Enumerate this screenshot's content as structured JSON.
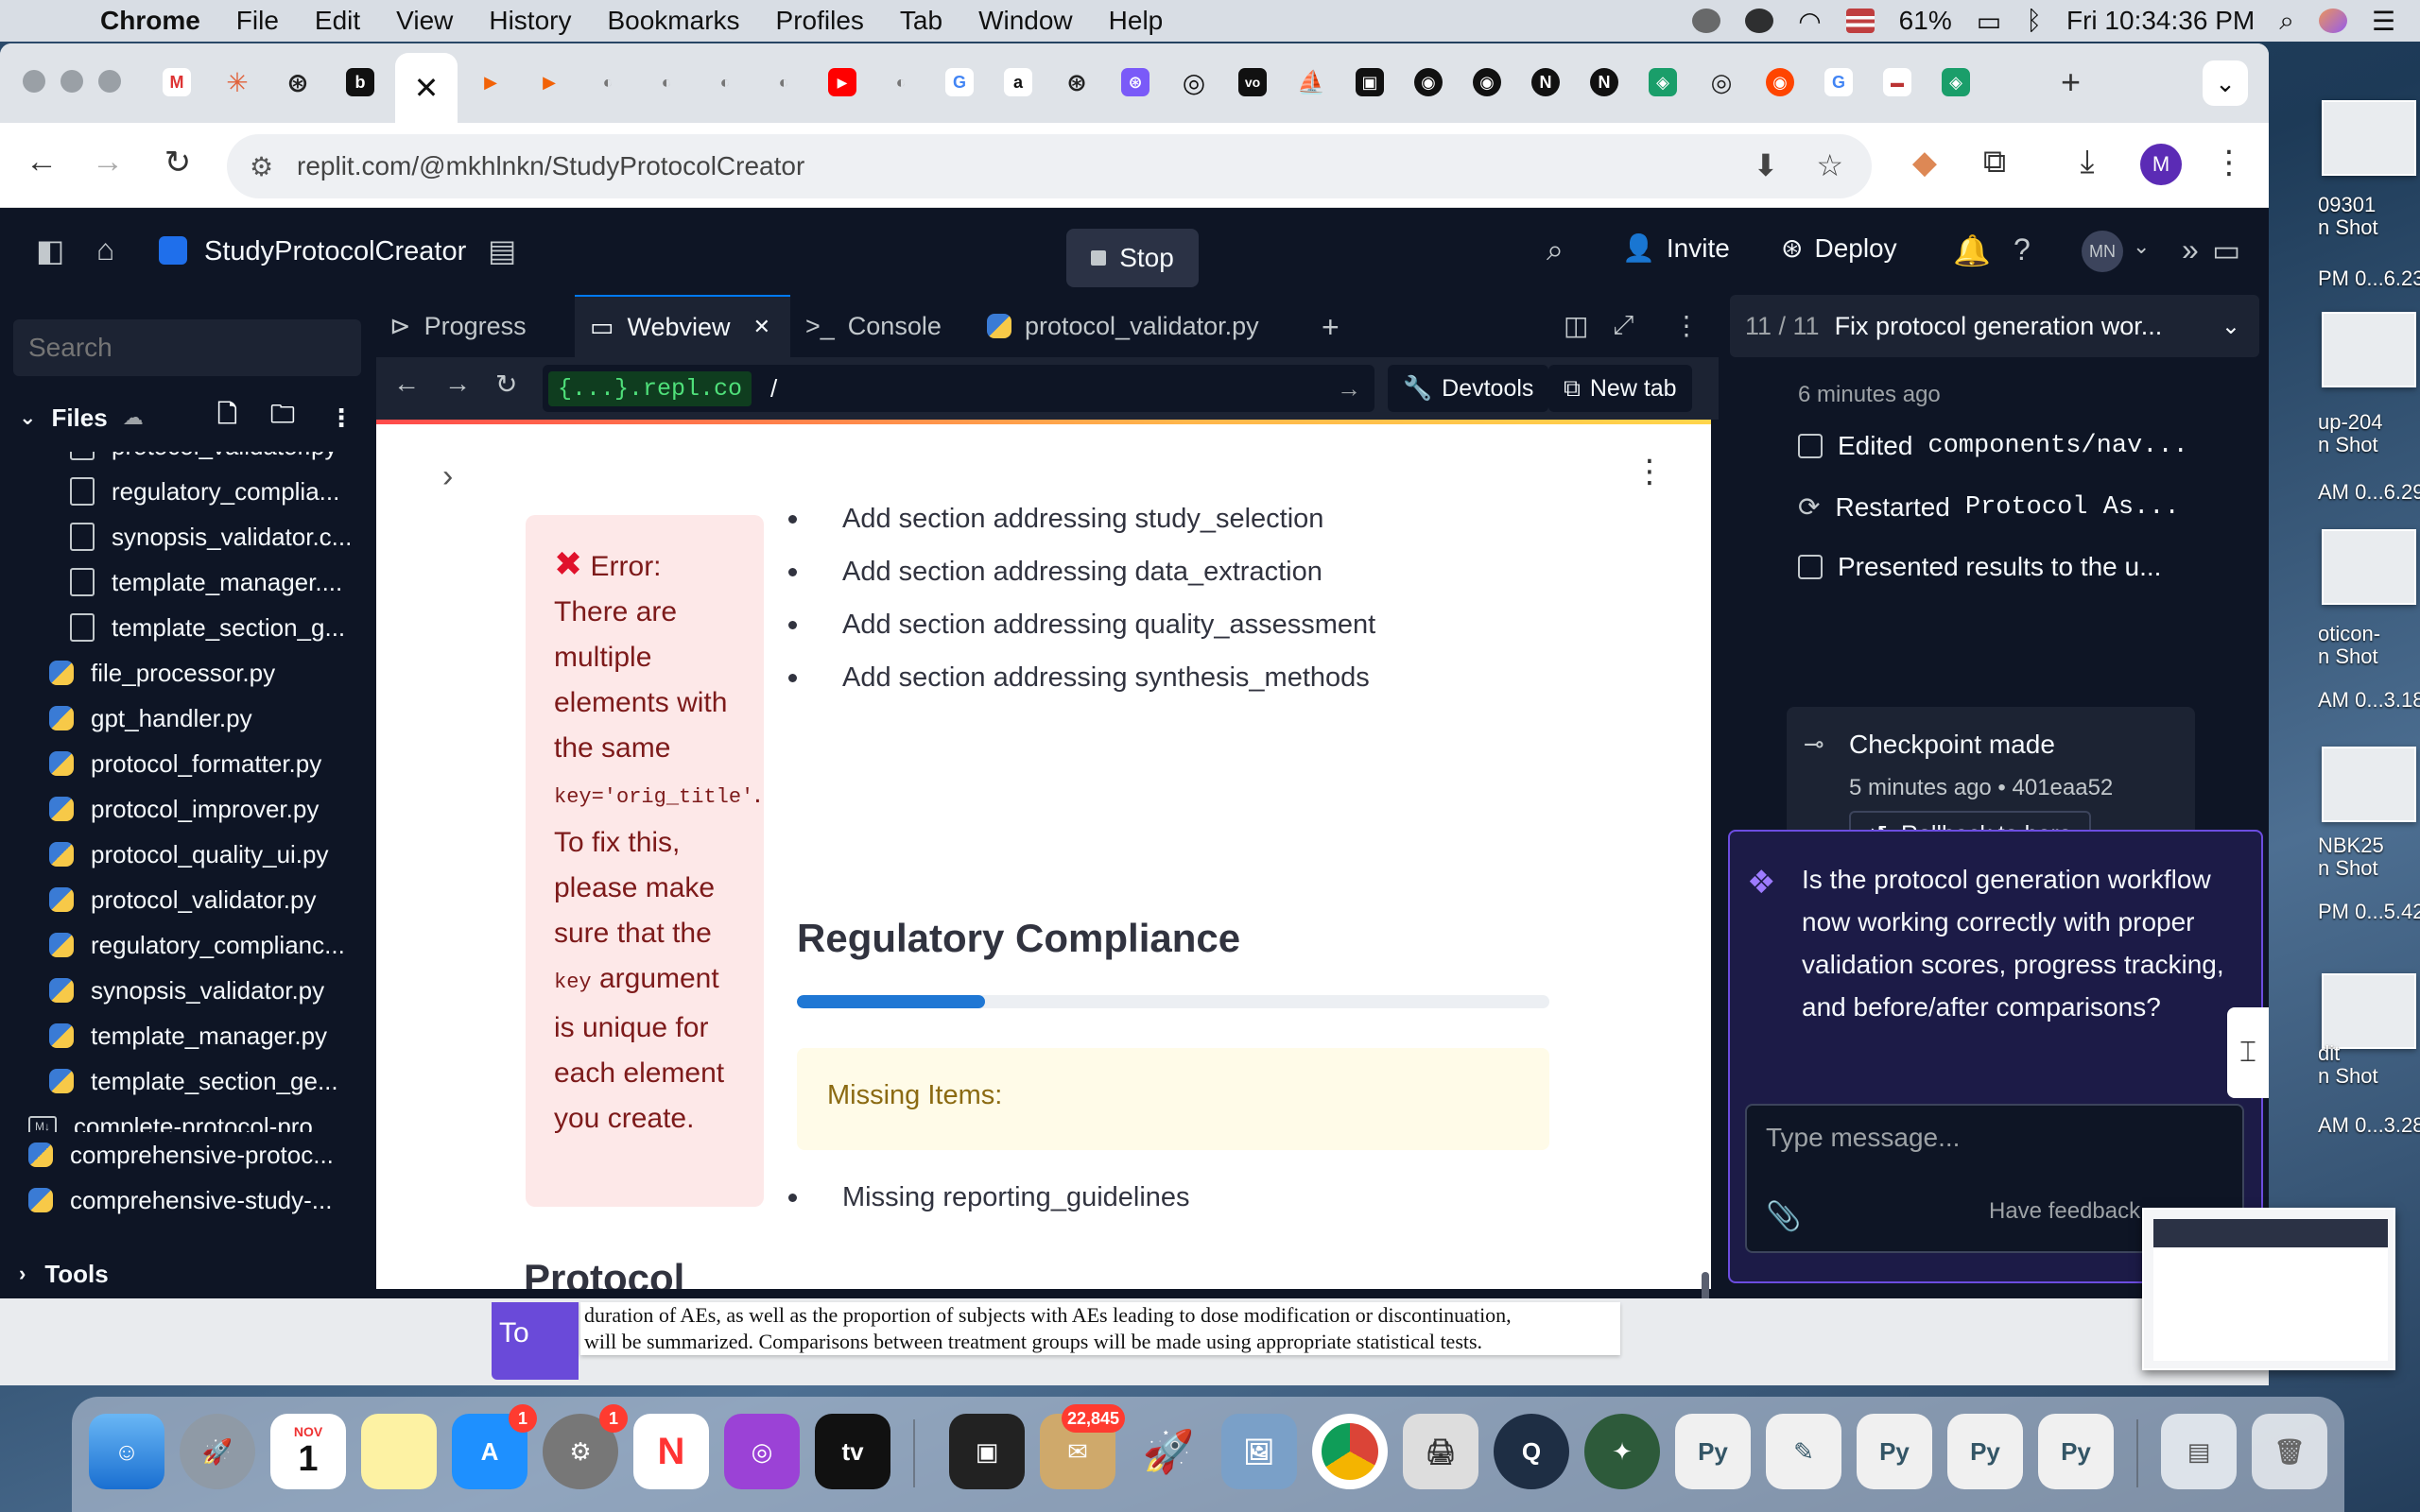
{
  "menubar": {
    "app_name": "Chrome",
    "items": [
      "File",
      "Edit",
      "View",
      "History",
      "Bookmarks",
      "Profiles",
      "Tab",
      "Window",
      "Help"
    ],
    "battery": "61%",
    "clock": "Fri 10:34:36 PM"
  },
  "browser": {
    "url": "replit.com/@mkhlnkn/StudyProtocolCreator",
    "profile_initial": "M",
    "active_tab_glyph": "✕",
    "tab_favicons": [
      "M",
      "✳",
      "⊛",
      "b",
      "▶",
      "▶",
      "◐",
      "◐",
      "◐",
      "◐",
      "▶",
      "◐",
      "G",
      "a",
      "⊛",
      "⊛",
      "◎",
      "vo",
      "⛵",
      "▣",
      "◉",
      "◉",
      "N",
      "N",
      "◈",
      "◎",
      "◉",
      "G",
      "▬",
      "◈"
    ]
  },
  "replit": {
    "project_name": "StudyProtocolCreator",
    "stop_label": "Stop",
    "invite_label": "Invite",
    "deploy_label": "Deploy",
    "avatar_initials": "MN",
    "sidebar": {
      "search_placeholder": "Search",
      "files_label": "Files",
      "tools_label": "Tools",
      "files": [
        {
          "name": "protocol_validator.py",
          "type": "doc",
          "indent": 2
        },
        {
          "name": "regulatory_complia...",
          "type": "doc",
          "indent": 2
        },
        {
          "name": "synopsis_validator.c...",
          "type": "doc",
          "indent": 2
        },
        {
          "name": "template_manager....",
          "type": "doc",
          "indent": 2
        },
        {
          "name": "template_section_g...",
          "type": "doc",
          "indent": 2
        },
        {
          "name": "file_processor.py",
          "type": "py",
          "indent": 1
        },
        {
          "name": "gpt_handler.py",
          "type": "py",
          "indent": 1
        },
        {
          "name": "protocol_formatter.py",
          "type": "py",
          "indent": 1
        },
        {
          "name": "protocol_improver.py",
          "type": "py",
          "indent": 1
        },
        {
          "name": "protocol_quality_ui.py",
          "type": "py",
          "indent": 1
        },
        {
          "name": "protocol_validator.py",
          "type": "py",
          "indent": 1
        },
        {
          "name": "regulatory_complianc...",
          "type": "py",
          "indent": 1
        },
        {
          "name": "synopsis_validator.py",
          "type": "py",
          "indent": 1
        },
        {
          "name": "template_manager.py",
          "type": "py",
          "indent": 1
        },
        {
          "name": "template_section_ge...",
          "type": "py",
          "indent": 1
        },
        {
          "name": "complete-protocol-pro...",
          "type": "md",
          "indent": 0
        },
        {
          "name": "comprehensive-protoc...",
          "type": "py",
          "indent": 0
        },
        {
          "name": "comprehensive-study-...",
          "type": "py",
          "indent": 0
        }
      ]
    },
    "tabs": {
      "progress": "Progress",
      "webview": "Webview",
      "console": "Console",
      "file": "protocol_validator.py"
    },
    "webview_bar": {
      "domain": "{...}.repl.co",
      "path": "/",
      "devtools": "Devtools",
      "new_tab": "New tab"
    },
    "webview": {
      "error_title": "Error:",
      "error_text_1": "There are multiple elements with the same",
      "error_code_1": "key='orig_title'",
      "error_text_2": ". To fix this, please make sure that the",
      "error_code_2": "key",
      "error_text_3": "argument is unique for each element you create.",
      "list_items": [
        "Add section addressing study_selection",
        "Add section addressing data_extraction",
        "Add section addressing quality_assessment",
        "Add section addressing synthesis_methods"
      ],
      "heading": "Regulatory Compliance",
      "compliance_progress": 0.25,
      "missing_label": "Missing Items:",
      "missing_items": [
        "Missing reporting_guidelines"
      ],
      "next_heading_partial": "Protocol"
    },
    "agent": {
      "counter": "11 / 11",
      "title": "Fix protocol generation wor...",
      "time": "6 minutes ago",
      "action_1_text": "Edited",
      "action_1_code": "components/nav...",
      "action_2_text": "Restarted",
      "action_2_code": "Protocol As...",
      "action_3": "Presented results to the u...",
      "checkpoint_title": "Checkpoint made",
      "checkpoint_meta": "5 minutes ago • 401eaa52",
      "rollback_label": "Rollback to here",
      "question": "Is the protocol generation workflow now working correctly with proper validation scores, progress tracking, and before/after comparisons?",
      "input_placeholder": "Type message...",
      "feedback": "Have feedback"
    }
  },
  "background_doc": {
    "purple_text": "To",
    "line_1": "duration of AEs, as well as the proportion of subjects with AEs leading to dose modification or discontinuation,",
    "line_2": "will be summarized. Comparisons between treatment groups will be made using appropriate statistical tests."
  },
  "desktop_labels": [
    "09301",
    "n Shot",
    "PM 0...6.23",
    "up-204",
    "n Shot",
    "AM 0...6.29",
    "oticon-",
    "n Shot",
    "AM 0...3.18",
    "NBK25",
    "n Shot",
    "PM 0...5.42",
    "dit",
    "n Shot",
    "AM 0...3.28"
  ],
  "dock": {
    "mail_badge": "22,845",
    "appstore_badge": "1",
    "settings_badge": "1",
    "calendar_month": "NOV",
    "calendar_day": "1",
    "tv_label": "tv"
  }
}
